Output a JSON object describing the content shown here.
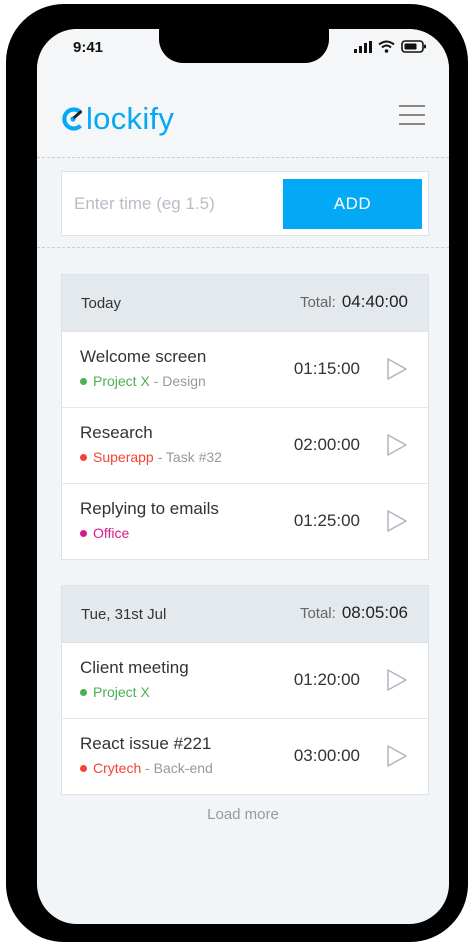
{
  "status_bar": {
    "time": "9:41"
  },
  "header": {
    "logo_text": "lockify"
  },
  "time_entry": {
    "placeholder": "Enter time (eg 1.5)",
    "add_label": "ADD"
  },
  "days": [
    {
      "label": "Today",
      "total_label": "Total:",
      "total": "04:40:00",
      "entries": [
        {
          "description": "Welcome screen",
          "project": "Project X",
          "project_color": "#4caf50",
          "task": " - Design",
          "duration": "01:15:00"
        },
        {
          "description": "Research",
          "project": "Superapp",
          "project_color": "#f44336",
          "task": " - Task #32",
          "duration": "02:00:00"
        },
        {
          "description": "Replying to emails",
          "project": "Office",
          "project_color": "#d81b8a",
          "task": "",
          "duration": "01:25:00"
        }
      ]
    },
    {
      "label": "Tue, 31st Jul",
      "total_label": "Total:",
      "total": "08:05:06",
      "entries": [
        {
          "description": "Client meeting",
          "project": "Project X",
          "project_color": "#4caf50",
          "task": "",
          "duration": "01:20:00"
        },
        {
          "description": "React issue #221",
          "project": "Crytech",
          "project_color": "#f44336",
          "task": " - Back-end",
          "duration": "03:00:00"
        }
      ]
    }
  ],
  "load_more": "Load more",
  "colors": {
    "accent": "#03a9f4",
    "background": "#f2f5f8"
  },
  "icons": {
    "menu": "hamburger-menu-icon",
    "play": "play-icon",
    "logo": "clockify-logo-icon"
  }
}
